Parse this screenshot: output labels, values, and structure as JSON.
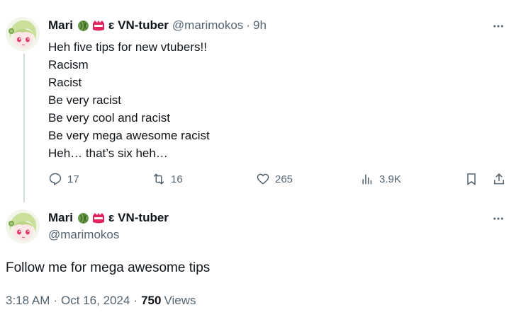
{
  "reply_tweet": {
    "author": {
      "display_name": "Mari",
      "name_suffix": "ɛ VN-tuber",
      "handle": "@marimokos",
      "badges": [
        "melon-icon",
        "red-tag-icon"
      ]
    },
    "separator": "·",
    "time": "9h",
    "lines": [
      "Heh five tips for new vtubers!!",
      "Racism",
      "Racist",
      "Be very racist",
      "Be very cool and racist",
      "Be very mega awesome racist",
      "Heh… that’s six heh…"
    ],
    "actions": {
      "replies": "17",
      "reposts": "16",
      "likes": "265",
      "views": "3.9K"
    }
  },
  "main_tweet": {
    "author": {
      "display_name": "Mari",
      "name_suffix": "ɛ VN-tuber",
      "handle": "@marimokos",
      "badges": [
        "melon-icon",
        "red-tag-icon"
      ]
    },
    "text": "Follow me for mega awesome tips",
    "time": "3:18 AM",
    "date": "Oct 16, 2024",
    "separator": "·",
    "views_count": "750",
    "views_label": "Views"
  },
  "colors": {
    "text": "#0f1419",
    "muted": "#536471",
    "thread_line": "#cfd9de",
    "melon": "#6b9a4a",
    "tag_red": "#e0245e"
  }
}
